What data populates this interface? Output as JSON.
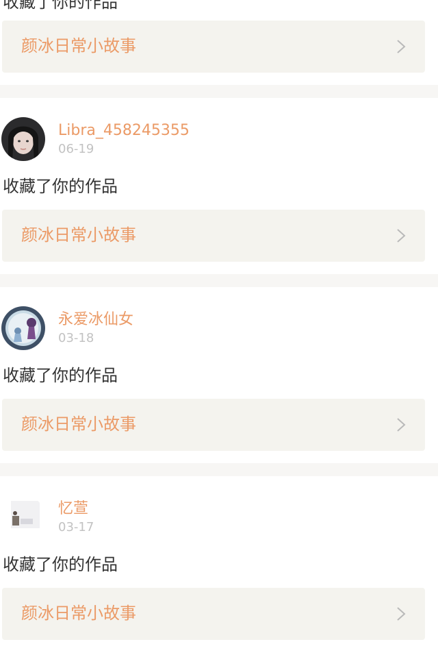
{
  "feed": [
    {
      "user": "",
      "date": "",
      "action": "收藏了你的作品",
      "work_title": "颜冰日常小故事",
      "avatar_icon": ""
    },
    {
      "user": "Libra_458245355",
      "date": "06-19",
      "action": "收藏了你的作品",
      "work_title": "颜冰日常小故事",
      "avatar_icon": "portrait-avatar"
    },
    {
      "user": "永爱冰仙女",
      "date": "03-18",
      "action": "收藏了你的作品",
      "work_title": "颜冰日常小故事",
      "avatar_icon": "anime-figures-avatar"
    },
    {
      "user": "忆萱",
      "date": "03-17",
      "action": "收藏了你的作品",
      "work_title": "颜冰日常小故事",
      "avatar_icon": "room-photo-avatar"
    }
  ],
  "colors": {
    "accent": "#eb9a66",
    "date_gray": "#c2c2c2",
    "text": "#333333",
    "card_bg": "#f4f3ee",
    "separator_bg": "#f7f6f4"
  }
}
